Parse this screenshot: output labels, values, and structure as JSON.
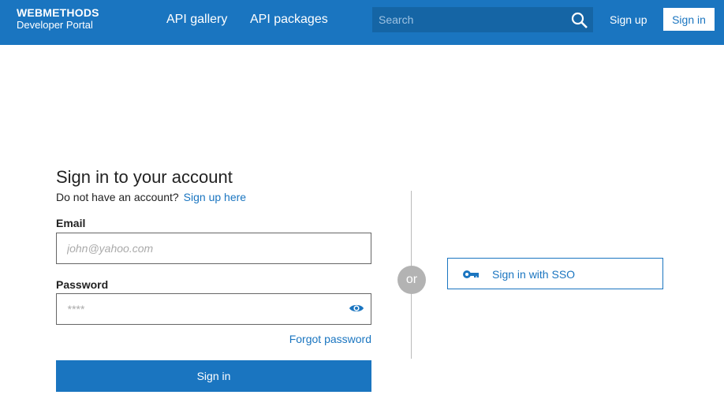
{
  "header": {
    "logo_line1": "WEBMETHODS",
    "logo_line2": "Developer Portal",
    "nav": [
      "API gallery",
      "API packages"
    ],
    "search_placeholder": "Search",
    "signup": "Sign up",
    "signin": "Sign in"
  },
  "form": {
    "title": "Sign in to your account",
    "no_account": "Do not have an account?",
    "signup_link": "Sign up here",
    "email_label": "Email",
    "email_placeholder": "john@yahoo.com",
    "password_label": "Password",
    "password_placeholder": "****",
    "forgot": "Forgot password",
    "submit": "Sign in"
  },
  "or": "or",
  "sso": "Sign in with SSO",
  "colors": {
    "brand": "#1a75c0"
  }
}
